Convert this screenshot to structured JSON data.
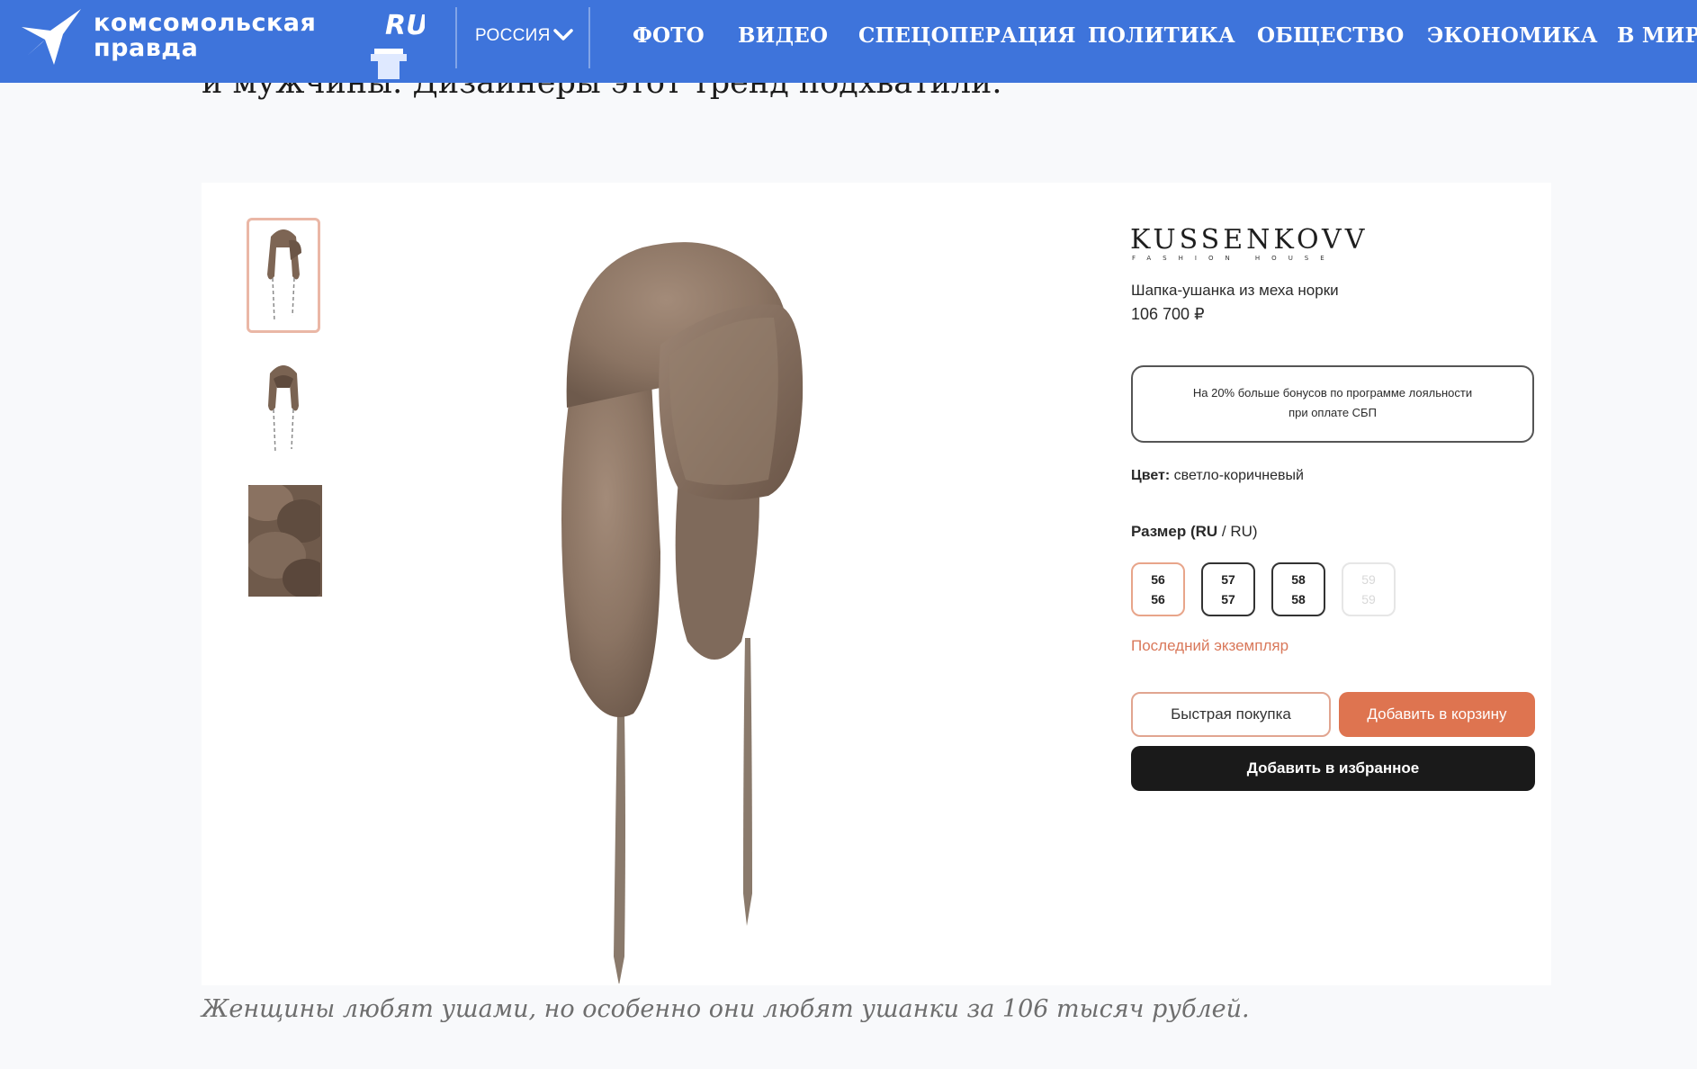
{
  "header": {
    "logo_line1": "Комсомольская",
    "logo_line2": "правда",
    "logo_ru": "RU",
    "region": "РОССИЯ",
    "nav": [
      "ФОТО",
      "ВИДЕО",
      "СПЕЦОПЕРАЦИЯ",
      "ПОЛИТИКА",
      "ОБЩЕСТВО",
      "ЭКОНОМИКА",
      "В МИРЕ"
    ]
  },
  "article": {
    "partial_line": "и мужчины. Дизайнеры этот тренд подхватили.",
    "caption": "Женщины любят ушами, но особенно они любят ушанки за 106 тысяч рублей."
  },
  "product": {
    "brand": "KUSSENKOVV",
    "brand_sub": "FASHION HOUSE",
    "name": "Шапка-ушанка из меха норки",
    "price": "106 700 ₽",
    "bonus_line1": "На 20% больше бонусов по программе лояльности",
    "bonus_line2": "при оплате СБП",
    "color_label": "Цвет:",
    "color_value": "светло-коричневый",
    "size_label": "Размер (RU",
    "size_label_rest": " / RU)",
    "sizes": [
      {
        "top": "56",
        "bottom": "56"
      },
      {
        "top": "57",
        "bottom": "57"
      },
      {
        "top": "58",
        "bottom": "58"
      },
      {
        "top": "59",
        "bottom": "59"
      }
    ],
    "last_copy": "Последний экземпляр",
    "quick_buy": "Быстрая покупка",
    "add_to_cart": "Добавить в корзину",
    "add_to_favorites": "Добавить в избранное"
  },
  "colors": {
    "header_bg": "#3e74db",
    "accent_orange": "#de7450",
    "fur_brown": "#8f7866"
  }
}
